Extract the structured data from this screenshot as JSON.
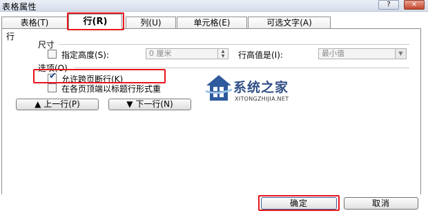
{
  "window": {
    "title": "表格属性",
    "help_button": "?",
    "close_button": "×"
  },
  "tabs": [
    {
      "label": "表格(T)"
    },
    {
      "label": "行(R)"
    },
    {
      "label": "列(U)"
    },
    {
      "label": "单元格(E)"
    },
    {
      "label": "可选文字(A)"
    }
  ],
  "row_tab": {
    "heading": "行",
    "size": {
      "heading": "尺寸",
      "specify_height_label": "指定高度(S):",
      "specify_height_checked": false,
      "height_value": "0 厘米",
      "row_height_is_label": "行高值是(I):",
      "row_height_is_value": "最小值"
    },
    "options": {
      "heading": "选项(O)",
      "allow_break_label": "允许跨页断行(K)",
      "allow_break_checked": true,
      "repeat_header_label": "在各页顶端以标题行形式重",
      "repeat_header_checked": false
    },
    "prev_row_label": "上一行(P)",
    "next_row_label": "下一行(N)"
  },
  "watermark": {
    "title": "系统之家",
    "url": "XITONGZHIJIA.NET"
  },
  "footer": {
    "ok_label": "确定",
    "cancel_label": "取消"
  },
  "colors": {
    "highlight": "#e8141a",
    "watermark": "#2f4f86"
  }
}
